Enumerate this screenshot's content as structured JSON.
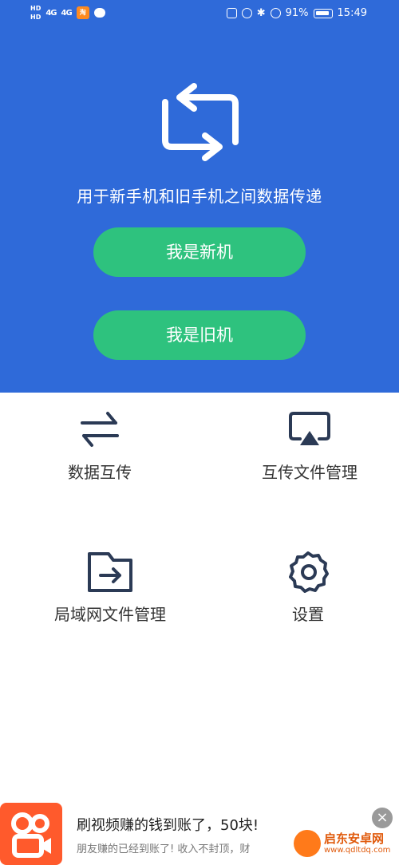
{
  "status_bar": {
    "hd1": "HD",
    "hd2": "HD",
    "signal1": "4G",
    "signal2": "4G",
    "app_badge": "淘",
    "battery_percent": "91%",
    "time": "15:49"
  },
  "hero": {
    "subtitle": "用于新手机和旧手机之间数据传递",
    "new_phone_button": "我是新机",
    "old_phone_button": "我是旧机",
    "background_color": "#2f6ad9",
    "button_color": "#2ec27e"
  },
  "features": [
    {
      "label": "数据互传",
      "icon": "transfer-arrows-icon"
    },
    {
      "label": "互传文件管理",
      "icon": "airplay-icon"
    },
    {
      "label": "局域网文件管理",
      "icon": "folder-arrow-icon"
    },
    {
      "label": "设置",
      "icon": "gear-icon"
    }
  ],
  "ad": {
    "title": "刷视频赚的钱到账了，50块!",
    "description": "朋友赚的已经到账了! 收入不封顶，财",
    "close": "×",
    "watermark_name": "启东安卓网",
    "watermark_url": "www.qdltdq.com"
  }
}
